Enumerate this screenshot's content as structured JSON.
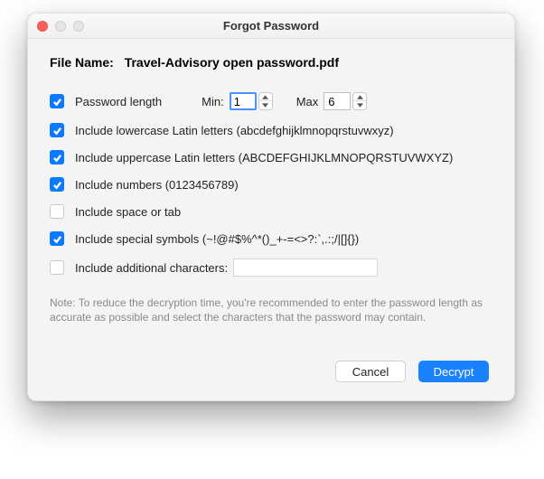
{
  "window": {
    "title": "Forgot Password"
  },
  "file": {
    "label": "File Name:",
    "value": "Travel-Advisory open password.pdf"
  },
  "options": {
    "password_length": {
      "label": "Password length",
      "checked": true,
      "min_label": "Min:",
      "min_value": "1",
      "max_label": "Max",
      "max_value": "6"
    },
    "lowercase": {
      "label": "Include lowercase Latin letters (abcdefghijklmnopqrstuvwxyz)",
      "checked": true
    },
    "uppercase": {
      "label": "Include uppercase Latin letters (ABCDEFGHIJKLMNOPQRSTUVWXYZ)",
      "checked": true
    },
    "numbers": {
      "label": "Include numbers (0123456789)",
      "checked": true
    },
    "space_tab": {
      "label": "Include space or tab",
      "checked": false
    },
    "special": {
      "label": "Include special symbols (~!@#$%^*()_+-=<>?:`,.:;/|[]{})",
      "checked": true
    },
    "additional": {
      "label": "Include additional characters:",
      "checked": false,
      "value": ""
    }
  },
  "note": "Note: To reduce the decryption time, you're recommended to enter the password length as accurate as possible and select the characters that the password may contain.",
  "buttons": {
    "cancel": "Cancel",
    "decrypt": "Decrypt"
  }
}
